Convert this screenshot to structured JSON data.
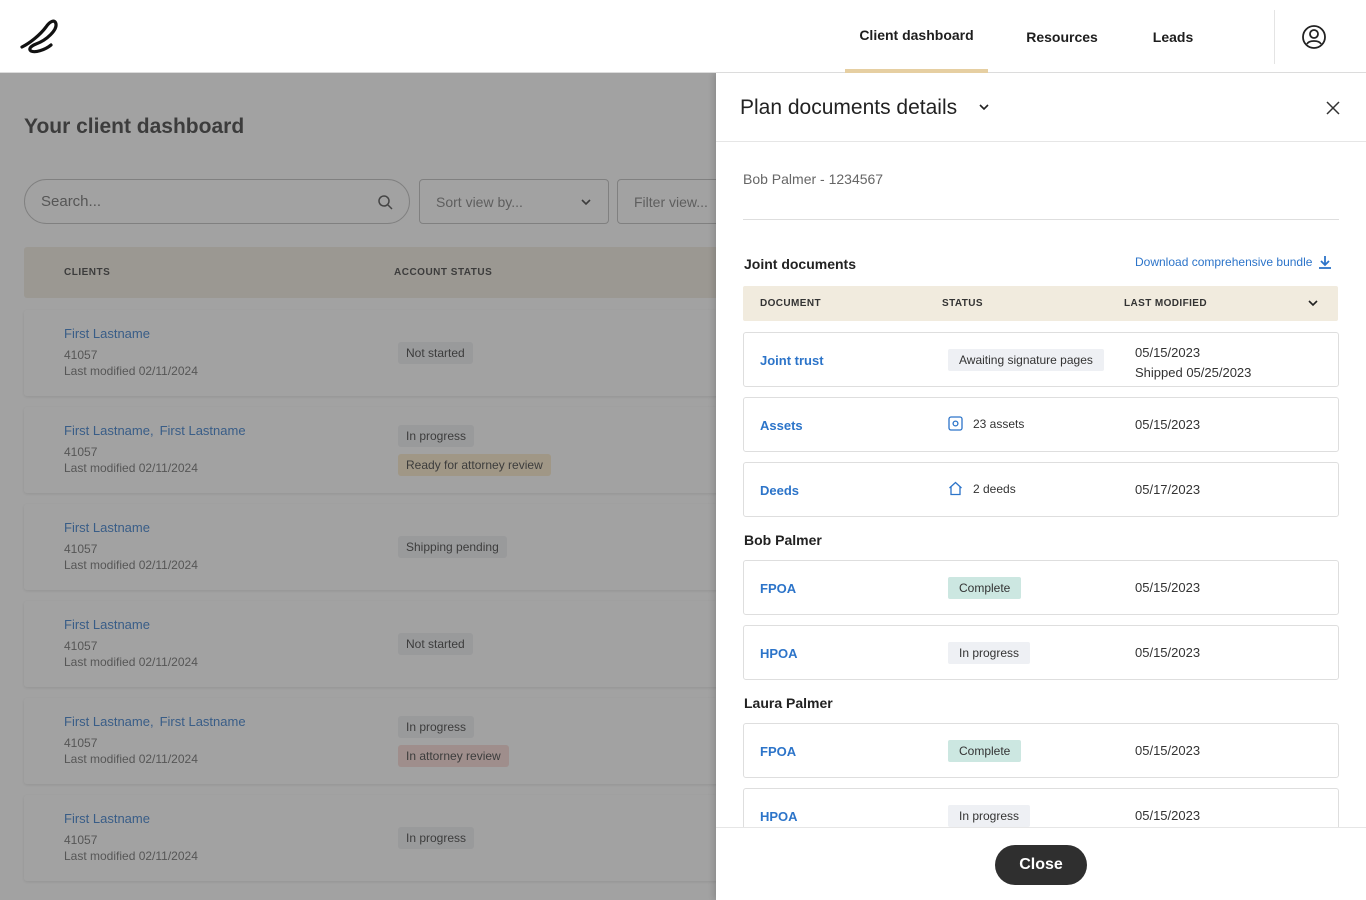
{
  "nav": {
    "items": [
      {
        "label": "Client dashboard",
        "active": true
      },
      {
        "label": "Resources",
        "active": false
      },
      {
        "label": "Leads",
        "active": false
      }
    ]
  },
  "dashboard": {
    "title": "Your client dashboard",
    "search_placeholder": "Search...",
    "sort_placeholder": "Sort view by...",
    "filter_placeholder": "Filter view...",
    "columns": [
      "CLIENTS",
      "ACCOUNT STATUS"
    ],
    "rows": [
      {
        "names": [
          "First Lastname"
        ],
        "id": "41057",
        "modified": "Last modified 02/11/2024",
        "badges": [
          {
            "text": "Not started",
            "tone": "gray"
          }
        ]
      },
      {
        "names": [
          "First Lastname,",
          "First Lastname"
        ],
        "id": "41057",
        "modified": "Last modified 02/11/2024",
        "badges": [
          {
            "text": "In progress",
            "tone": "gray"
          },
          {
            "text": "Ready for attorney review",
            "tone": "yellow"
          }
        ]
      },
      {
        "names": [
          "First Lastname"
        ],
        "id": "41057",
        "modified": "Last modified 02/11/2024",
        "badges": [
          {
            "text": "Shipping pending",
            "tone": "gray"
          }
        ]
      },
      {
        "names": [
          "First Lastname"
        ],
        "id": "41057",
        "modified": "Last modified 02/11/2024",
        "badges": [
          {
            "text": "Not started",
            "tone": "gray"
          }
        ]
      },
      {
        "names": [
          "First Lastname,",
          "First Lastname"
        ],
        "id": "41057",
        "modified": "Last modified 02/11/2024",
        "badges": [
          {
            "text": "In progress",
            "tone": "gray"
          },
          {
            "text": "In attorney review",
            "tone": "red"
          }
        ]
      },
      {
        "names": [
          "First Lastname"
        ],
        "id": "41057",
        "modified": "Last modified 02/11/2024",
        "badges": [
          {
            "text": "In progress",
            "tone": "gray"
          }
        ]
      }
    ]
  },
  "drawer": {
    "title": "Plan documents details",
    "client": "Bob Palmer - 1234567",
    "download_label": "Download comprehensive bundle",
    "columns": {
      "document": "DOCUMENT",
      "status": "STATUS",
      "modified": "LAST MODIFIED"
    },
    "sections": [
      {
        "title": "Joint documents",
        "docs": [
          {
            "name": "Joint trust",
            "status": "Awaiting signature pages",
            "status_kind": "badge",
            "date": "05/15/2023",
            "date2": "Shipped 05/25/2023"
          },
          {
            "name": "Assets",
            "status": "23 assets",
            "status_kind": "assets",
            "icon": "asset-icon",
            "date": "05/15/2023"
          },
          {
            "name": "Deeds",
            "status": "2 deeds",
            "status_kind": "deeds",
            "icon": "house-icon",
            "date": "05/17/2023"
          }
        ]
      },
      {
        "title": "Bob Palmer",
        "docs": [
          {
            "name": "FPOA",
            "status": "Complete",
            "status_kind": "complete",
            "date": "05/15/2023"
          },
          {
            "name": "HPOA",
            "status": "In progress",
            "status_kind": "badge",
            "date": "05/15/2023"
          }
        ]
      },
      {
        "title": "Laura Palmer",
        "docs": [
          {
            "name": "FPOA",
            "status": "Complete",
            "status_kind": "complete",
            "date": "05/15/2023"
          },
          {
            "name": "HPOA",
            "status": "In progress",
            "status_kind": "badge",
            "date": "05/15/2023"
          }
        ]
      }
    ],
    "close_label": "Close"
  },
  "colors": {
    "accent_link": "#2c74c9",
    "header_beige": "#f1ebde",
    "nav_underline": "#e6cfa2",
    "complete_badge": "#cce7e1",
    "button_dark": "#2f2f2f"
  }
}
